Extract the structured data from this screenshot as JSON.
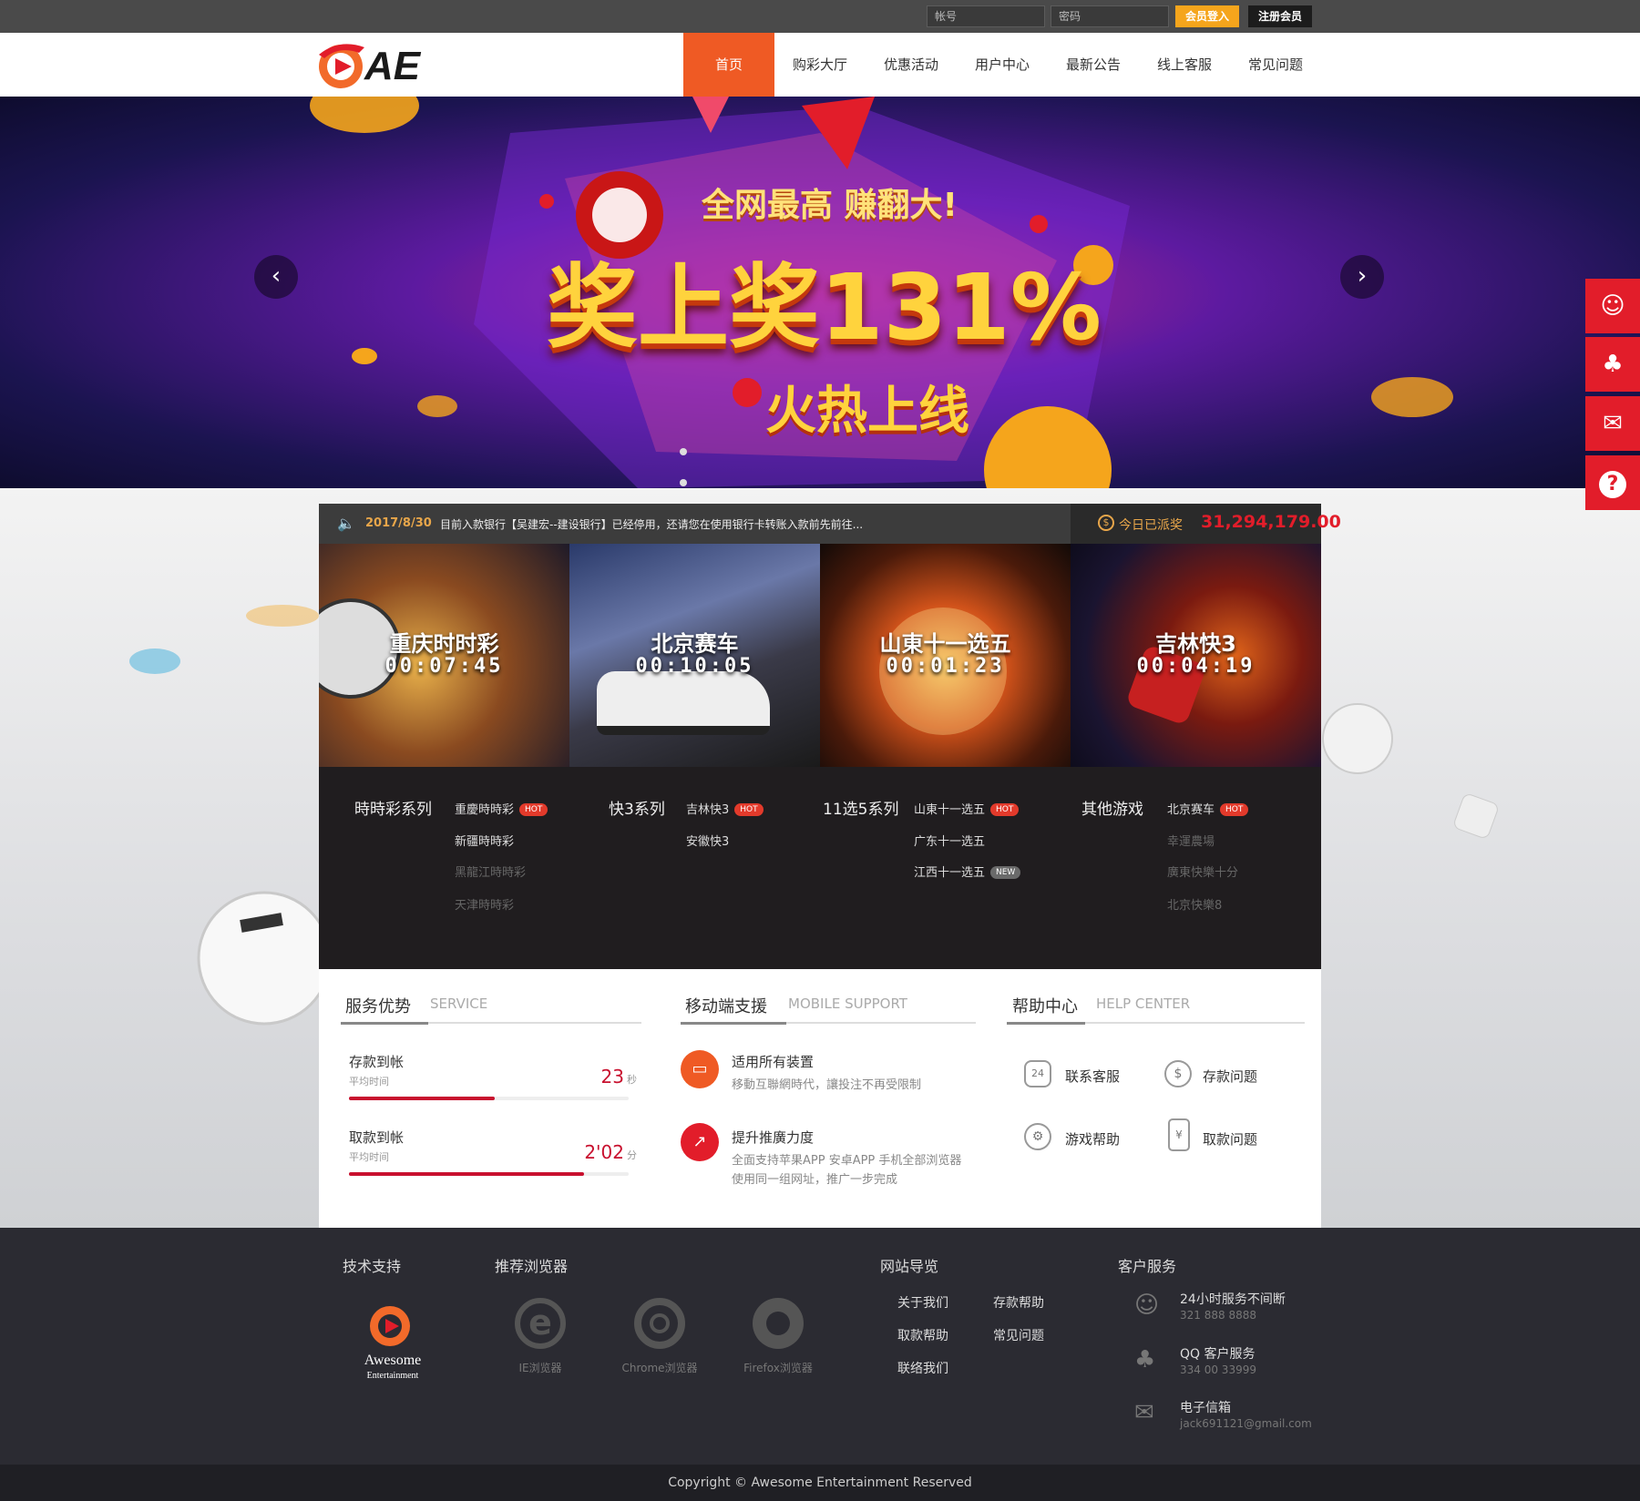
{
  "topbar": {
    "account_placeholder": "帐号",
    "password_placeholder": "密码",
    "login_label": "会员登入",
    "register_label": "注册会员"
  },
  "logo": {
    "text": "AE"
  },
  "nav": {
    "items": [
      "首页",
      "购彩大厅",
      "优惠活动",
      "用户中心",
      "最新公告",
      "线上客服",
      "常见问题"
    ],
    "active_index": 0
  },
  "banner": {
    "line1": "全网最高 赚翻大!",
    "line2": "奖上奖131%",
    "line3": "火热上线",
    "prev_icon": "chevron-left-icon",
    "next_icon": "chevron-right-icon"
  },
  "side_buttons": [
    "customer-service-icon",
    "qq-icon",
    "mail-icon",
    "help-icon"
  ],
  "notice": {
    "date": "2017/8/30",
    "text": "目前入款银行【吴建宏--建设银行】已经停用，还请您在使用银行卡转账入款前先前往...",
    "today_label": "今日已派奖",
    "today_amount": "31,294,179.00"
  },
  "game_tiles": [
    {
      "name": "重庆时时彩",
      "time": "00:07:45"
    },
    {
      "name": "北京赛车",
      "time": "00:10:05"
    },
    {
      "name": "山東十一选五",
      "time": "00:01:23"
    },
    {
      "name": "吉林快3",
      "time": "00:04:19"
    }
  ],
  "categories": [
    {
      "title": "時時彩系列",
      "items": [
        {
          "label": "重慶時時彩",
          "badge": "HOT",
          "dim": false
        },
        {
          "label": "新疆時時彩",
          "badge": "",
          "dim": false
        },
        {
          "label": "黑龍江時時彩",
          "badge": "",
          "dim": true
        },
        {
          "label": "天津時時彩",
          "badge": "",
          "dim": true
        }
      ]
    },
    {
      "title": "快3系列",
      "items": [
        {
          "label": "吉林快3",
          "badge": "HOT",
          "dim": false
        },
        {
          "label": "安徽快3",
          "badge": "",
          "dim": false
        }
      ]
    },
    {
      "title": "11选5系列",
      "items": [
        {
          "label": "山東十一选五",
          "badge": "HOT",
          "dim": false
        },
        {
          "label": "广东十一选五",
          "badge": "",
          "dim": false
        },
        {
          "label": "江西十一选五",
          "badge": "NEW",
          "dim": false
        }
      ]
    },
    {
      "title": "其他游戏",
      "items": [
        {
          "label": "北京赛车",
          "badge": "HOT",
          "dim": false
        },
        {
          "label": "幸運農場",
          "badge": "",
          "dim": true
        },
        {
          "label": "廣東快樂十分",
          "badge": "",
          "dim": true
        },
        {
          "label": "北京快樂8",
          "badge": "",
          "dim": true
        }
      ]
    }
  ],
  "service": {
    "title": "服务优势",
    "subtitle": "SERVICE",
    "rows": [
      {
        "label": "存款到帐",
        "sub": "平均时间",
        "value": "23",
        "unit": "秒",
        "progress": 0.52
      },
      {
        "label": "取款到帐",
        "sub": "平均时间",
        "value": "2'02",
        "unit": "分",
        "progress": 0.84
      }
    ]
  },
  "mobile": {
    "title": "移动端支援",
    "subtitle": "MOBILE SUPPORT",
    "items": [
      {
        "title": "适用所有装置",
        "desc1": "移動互聯網時代，讓投注不再受限制",
        "desc2": ""
      },
      {
        "title": "提升推廣力度",
        "desc1": "全面支持苹果APP 安卓APP 手机全部浏览器",
        "desc2": "使用同一组网址，推广一步完成"
      }
    ]
  },
  "help": {
    "title": "帮助中心",
    "subtitle": "HELP CENTER",
    "items": [
      "联系客服",
      "存款问题",
      "游戏帮助",
      "取款问题"
    ]
  },
  "footer": {
    "tech_title": "技术支持",
    "brand_line1": "Awesome",
    "brand_line2": "Entertainment",
    "browser_title": "推荐浏览器",
    "browsers": [
      "IE浏览器",
      "Chrome浏览器",
      "Firefox浏览器"
    ],
    "nav_title": "网站导览",
    "nav_links": [
      "关于我们",
      "存款帮助",
      "取款帮助",
      "常见问题",
      "联络我们"
    ],
    "cs_title": "客户服务",
    "cs_items": [
      {
        "title": "24小时服务不间断",
        "detail": "321 888 8888"
      },
      {
        "title": "QQ 客户服务",
        "detail": "334 00 33999"
      },
      {
        "title": "电子信箱",
        "detail": "jack691121@gmail.com"
      }
    ],
    "copyright": "Copyright © Awesome Entertainment Reserved"
  },
  "colors": {
    "accent": "#ef5a24",
    "red": "#e21d2a",
    "gold": "#f5a51c"
  }
}
